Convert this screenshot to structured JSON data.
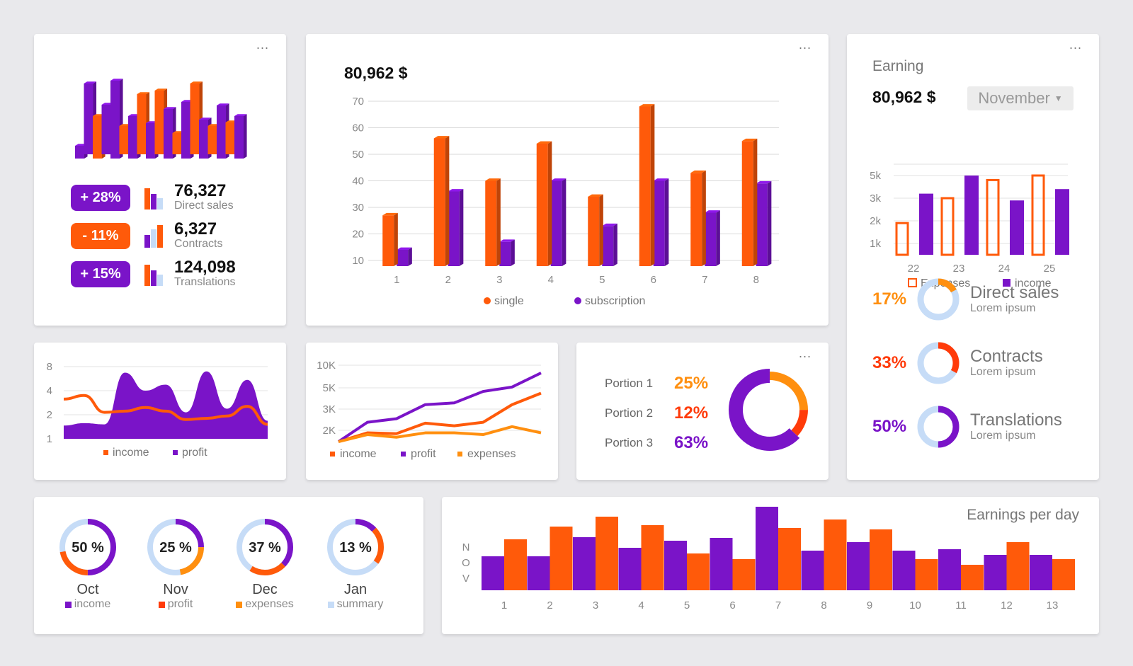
{
  "menu_glyph": "...",
  "colors": {
    "purple": "#7a14c8",
    "orange": "#ff5a0a",
    "amber": "#ff8f0f",
    "light_blue": "#c6dcf7"
  },
  "stats_card": {
    "items": [
      {
        "badge": "+ 28%",
        "value": "76,327",
        "label": "Direct sales",
        "badge_color": "#7a14c8"
      },
      {
        "badge": "- 11%",
        "value": "6,327",
        "label": "Contracts",
        "badge_color": "#ff5a0a"
      },
      {
        "badge": "+ 15%",
        "value": "124,098",
        "label": "Translations",
        "badge_color": "#7a14c8"
      }
    ]
  },
  "main_chart": {
    "total": "80,962 $",
    "chart_data": {
      "type": "bar",
      "categories": [
        "1",
        "2",
        "3",
        "4",
        "5",
        "6",
        "7",
        "8"
      ],
      "ylim": [
        10,
        70
      ],
      "yticks": [
        10,
        20,
        30,
        40,
        50,
        60,
        70
      ],
      "series": [
        {
          "name": "single",
          "values": [
            27,
            56,
            40,
            54,
            34,
            68,
            43,
            55
          ]
        },
        {
          "name": "subscription",
          "values": [
            14,
            36,
            17,
            40,
            23,
            40,
            28,
            39
          ]
        }
      ]
    }
  },
  "earning_card": {
    "title": "Earning",
    "total": "80,962 $",
    "month": "November",
    "chart_data": {
      "type": "bar",
      "categories": [
        "22",
        "23",
        "24",
        "25"
      ],
      "yticks": [
        "1k",
        "2k",
        "3k",
        "5k"
      ],
      "series": [
        {
          "name": "Expenses",
          "values": [
            1.4,
            2.5,
            3.3,
            3.5
          ]
        },
        {
          "name": "income",
          "values": [
            2.7,
            3.5,
            2.4,
            2.9
          ]
        }
      ]
    },
    "rings": [
      {
        "pct": "17%",
        "name": "Direct sales",
        "sub": "Lorem ipsum",
        "color": "#ff8f0f",
        "value": 0.17
      },
      {
        "pct": "33%",
        "name": "Contracts",
        "sub": "Lorem ipsum",
        "color": "#ff3b0a",
        "value": 0.33
      },
      {
        "pct": "50%",
        "name": "Translations",
        "sub": "Lorem ipsum",
        "color": "#7a14c8",
        "value": 0.5
      }
    ]
  },
  "area_chart": {
    "yticks": [
      "1",
      "2",
      "4",
      "8"
    ],
    "legend": [
      "income",
      "profit"
    ],
    "chart_data": {
      "type": "area",
      "series": [
        {
          "name": "income",
          "values": [
            3.3,
            3.6,
            2.2,
            2.3,
            2.6,
            2.3,
            1.6,
            1.7,
            1.9,
            2.7,
            1.2
          ]
        },
        {
          "name": "profit",
          "values": [
            1.1,
            1.3,
            1.2,
            5.5,
            4.0,
            4.5,
            2.2,
            5.6,
            2.5,
            4.9,
            1.5
          ]
        }
      ]
    }
  },
  "line_chart": {
    "yticks": [
      "2K",
      "3K",
      "5K",
      "10K"
    ],
    "legend": [
      "income",
      "profit",
      "expenses"
    ],
    "chart_data": {
      "type": "line",
      "ylim": [
        1000,
        10000
      ],
      "series": [
        {
          "name": "income",
          "values": [
            1000,
            2000,
            1900,
            3100,
            2800,
            3200,
            5200,
            6500
          ]
        },
        {
          "name": "profit",
          "values": [
            1000,
            3200,
            3600,
            5200,
            5400,
            6700,
            7200,
            8800
          ]
        },
        {
          "name": "expenses",
          "values": [
            1000,
            1800,
            1500,
            2000,
            2000,
            1800,
            2700,
            2000
          ]
        }
      ]
    }
  },
  "portions_card": {
    "items": [
      {
        "label": "Portion 1",
        "pct": "25%",
        "color": "#ff8f0f"
      },
      {
        "label": "Portion 2",
        "pct": "12%",
        "color": "#ff3b0a"
      },
      {
        "label": "Portion 3",
        "pct": "63%",
        "color": "#7a14c8"
      }
    ],
    "chart_data": {
      "type": "pie",
      "labels": [
        "Portion 1",
        "Portion 2",
        "Portion 3"
      ],
      "values": [
        25,
        12,
        63
      ]
    }
  },
  "donuts_card": {
    "items": [
      {
        "pct": "50 %",
        "month": "Oct",
        "legend": "income",
        "legend_color": "#7a14c8",
        "value": 0.5
      },
      {
        "pct": "25 %",
        "month": "Nov",
        "legend": "profit",
        "legend_color": "#ff3b0a",
        "value": 0.25
      },
      {
        "pct": "37 %",
        "month": "Dec",
        "legend": "expenses",
        "legend_color": "#ff8f0f",
        "value": 0.37
      },
      {
        "pct": "13 %",
        "month": "Jan",
        "legend": "summary",
        "legend_color": "#c6dcf7",
        "value": 0.13
      }
    ]
  },
  "per_day_chart": {
    "title": "Earnings per day",
    "side_label": [
      "N",
      "O",
      "V"
    ],
    "chart_data": {
      "type": "bar",
      "categories": [
        "1",
        "2",
        "3",
        "4",
        "5",
        "6",
        "7",
        "8",
        "9",
        "10",
        "11",
        "12",
        "13"
      ],
      "series": [
        {
          "name": "purple",
          "values": [
            48,
            48,
            75,
            60,
            70,
            74,
            118,
            56,
            68,
            56,
            58,
            50,
            50
          ]
        },
        {
          "name": "orange",
          "values": [
            72,
            90,
            104,
            92,
            52,
            44,
            88,
            100,
            86,
            44,
            36,
            68,
            44
          ]
        }
      ]
    }
  }
}
